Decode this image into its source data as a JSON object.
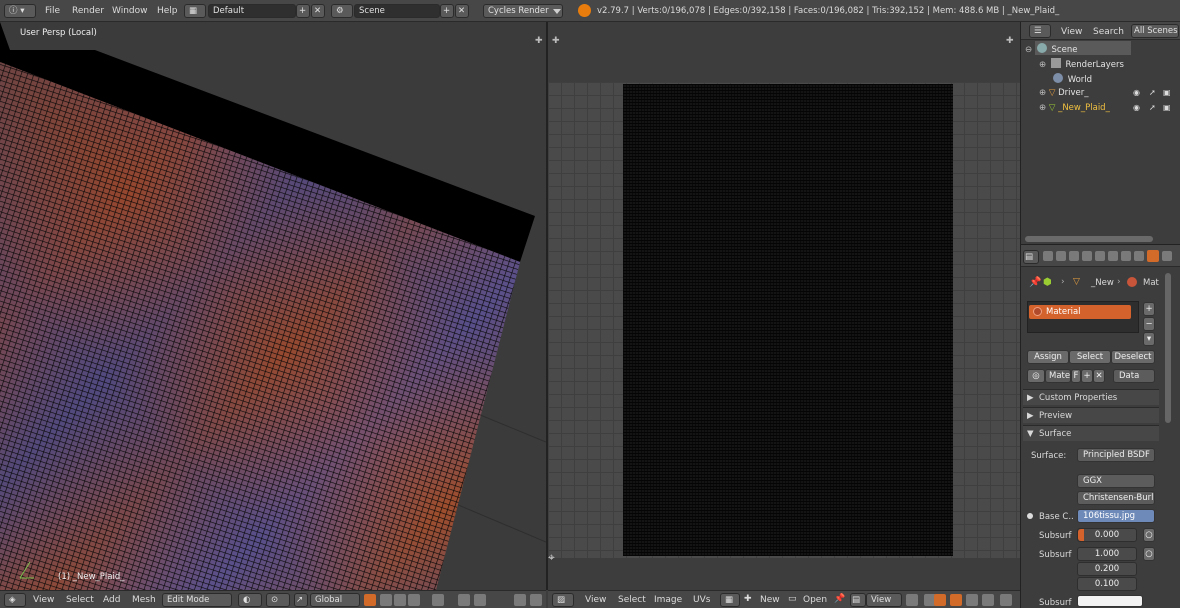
{
  "top_bar": {
    "menus": [
      "File",
      "Render",
      "Window",
      "Help"
    ],
    "screen_layout": "Default",
    "scene": "Scene",
    "render_engine": "Cycles Render",
    "stats": "v2.79.7 | Verts:0/196,078 | Edges:0/392,158 | Faces:0/196,082 | Tris:392,152 | Mem: 488.6 MB | _New_Plaid_"
  },
  "viewport": {
    "view_label": "User Persp (Local)",
    "object_label": "(1) _New_Plaid_",
    "bottom_menus": [
      "View",
      "Select",
      "Add",
      "Mesh"
    ],
    "mode": "Edit Mode",
    "orientation": "Global"
  },
  "uv_editor": {
    "bottom_menus": [
      "View",
      "Select",
      "Image",
      "UVs"
    ],
    "new_label": "New",
    "open_label": "Open",
    "view_label": "View"
  },
  "outliner": {
    "menus": [
      "View",
      "Search"
    ],
    "display_mode": "All Scenes",
    "items": [
      {
        "label": "Scene",
        "highlight": false
      },
      {
        "label": "RenderLayers",
        "highlight": false
      },
      {
        "label": "World",
        "highlight": false
      },
      {
        "label": "Driver_",
        "highlight": false
      },
      {
        "label": "_New_Plaid_",
        "highlight": true
      }
    ]
  },
  "properties": {
    "context_object": "_New",
    "context_material": "Mat",
    "material_slot": "Material",
    "assign_label": "Assign",
    "select_label": "Select",
    "deselect_label": "Deselect",
    "material_name": "Mate",
    "fake_user": "F",
    "link_label": "Data",
    "panels": {
      "custom_properties": "Custom Properties",
      "preview": "Preview",
      "surface": "Surface"
    },
    "surface_label": "Surface:",
    "surface_shader": "Principled BSDF",
    "distribution": "GGX",
    "subsurface_method": "Christensen-Burl...",
    "base_color_label": "Base C..",
    "base_color_texture": "106tissu.jpg",
    "subsurface_label": "Subsurf",
    "subsurface_value": "0.000",
    "subsurface_radius_label": "Subsurf",
    "subsurface_radius": [
      "1.000",
      "0.200",
      "0.100"
    ],
    "subsurface_color_label": "Subsurf"
  },
  "colors": {
    "accent_orange": "#d4622c",
    "header_bg": "#474747",
    "uv_bg": "#4a4a4a"
  }
}
